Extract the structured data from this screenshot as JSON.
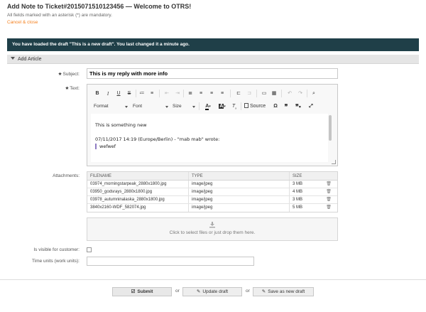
{
  "header": {
    "title": "Add Note to Ticket#2015071510123456 — Welcome to OTRS!",
    "subtitle": "All fields marked with an asterisk (*) are mandatory.",
    "cancel": "Cancel & close"
  },
  "draft_bar": {
    "text": "You have loaded the draft \"This is a new draft\". You last changed it a minute ago."
  },
  "section": {
    "title": "Add Article"
  },
  "form": {
    "subject_label": "Subject:",
    "subject_value": "This is my reply with more info",
    "text_label": "Text:",
    "attachments_label": "Attachments:",
    "visible_label": "Is visible for customer:",
    "time_units_label": "Time units (work units):",
    "star": "★"
  },
  "editor": {
    "toolbar1": [
      "B",
      "I",
      "U",
      "S",
      "≔",
      "≡",
      "⇤",
      "⇥",
      "≣",
      "≡",
      "≡",
      "≡",
      "⊏",
      "⊐",
      "▭",
      "▦",
      "↶",
      "↷",
      "⌕"
    ],
    "format": "Format",
    "font": "Font",
    "size": "Size",
    "source": "Source",
    "lines": [
      "This is something new",
      "07/11/2017 14:19 (Europe/Berlin) - \"mab mab\" wrote:",
      "wefwef"
    ]
  },
  "attachments": {
    "headers": [
      "FILENAME",
      "TYPE",
      "SIZE"
    ],
    "rows": [
      {
        "name": "03974_morningstarpeak_2880x1800.jpg",
        "type": "image/jpeg",
        "size": "3 MB"
      },
      {
        "name": "03950_godsrays_2880x1800.jpg",
        "type": "image/jpeg",
        "size": "4 MB"
      },
      {
        "name": "03978_autumninalaska_2880x1800.jpg",
        "type": "image/jpeg",
        "size": "3 MB"
      },
      {
        "name": "3840x2160-WDF_582074.jpg",
        "type": "image/jpeg",
        "size": "5 MB"
      }
    ],
    "dropzone_text": "Click to select files or just drop them here."
  },
  "footer": {
    "submit": "Submit",
    "or": "or",
    "update_draft": "Update draft",
    "save_new_draft": "Save as new draft"
  }
}
